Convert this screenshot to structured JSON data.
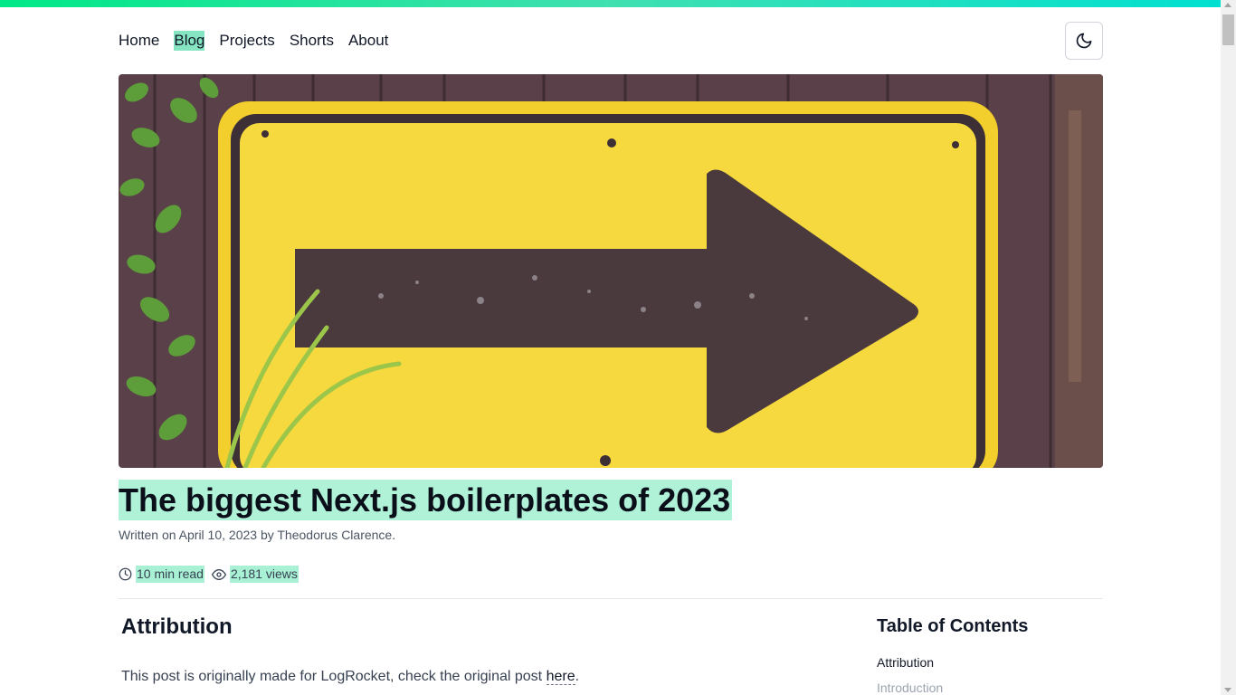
{
  "nav": {
    "items": [
      {
        "label": "Home",
        "active": false
      },
      {
        "label": "Blog",
        "active": true
      },
      {
        "label": "Projects",
        "active": false
      },
      {
        "label": "Shorts",
        "active": false
      },
      {
        "label": "About",
        "active": false
      }
    ],
    "theme_toggle_icon": "moon-icon"
  },
  "banner": {
    "icon": "banner-image",
    "colors": {
      "sign": "#f4d43a",
      "arrow": "#4a3a3e",
      "wood": "#5a4048"
    }
  },
  "post": {
    "title": "The biggest Next.js boilerplates of 2023",
    "byline": "Written on April 10, 2023 by Theodorus Clarence.",
    "read_time": "10 min read",
    "views": "2,181 views"
  },
  "article": {
    "heading": "Attribution",
    "paragraph_text": "This post is originally made for LogRocket, check the original post ",
    "paragraph_link": "here",
    "paragraph_end": "."
  },
  "toc": {
    "title": "Table of Contents",
    "items": [
      "Attribution",
      "Introduction"
    ]
  },
  "colors": {
    "accent": "#6ee7b7",
    "gradient_start": "#00e887",
    "gradient_end": "#00e0d0"
  }
}
